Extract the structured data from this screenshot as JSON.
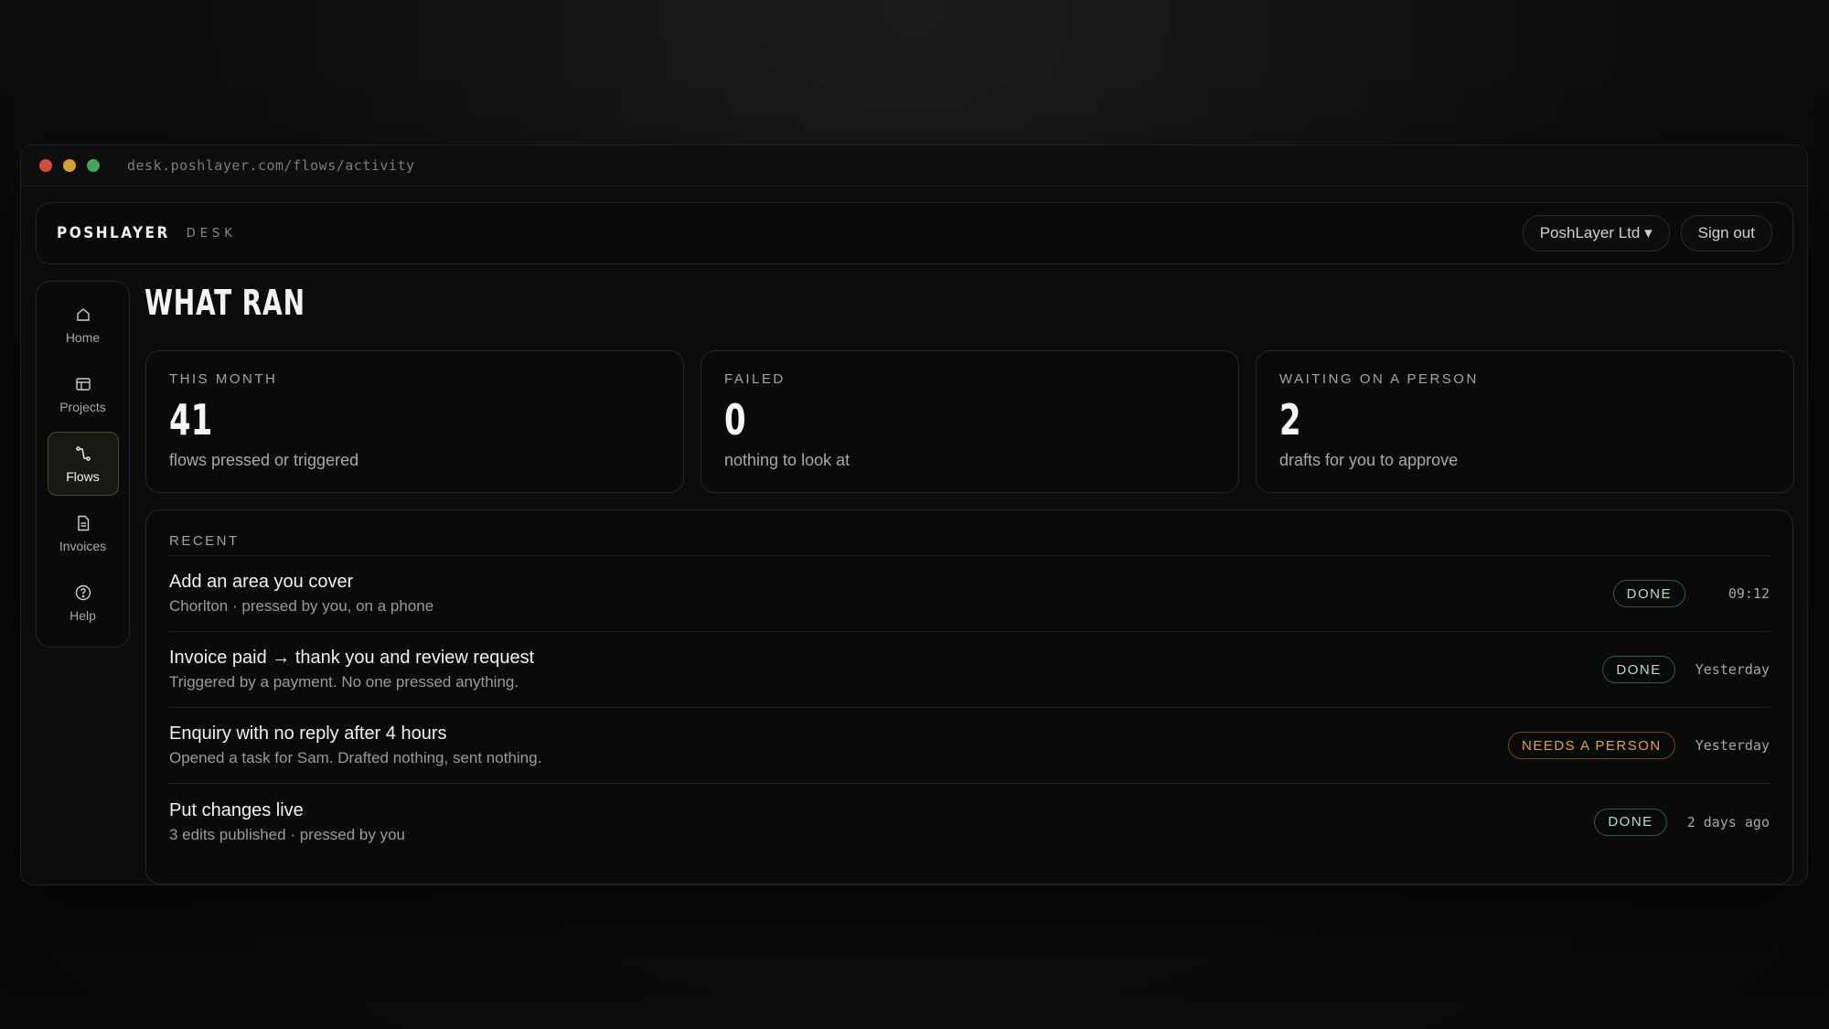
{
  "browser": {
    "url": "desk.poshlayer.com/flows/activity"
  },
  "header": {
    "brand": "POSHLAYER",
    "brand_sub": "DESK",
    "org_selector": "PoshLayer Ltd ▾",
    "sign_out": "Sign out"
  },
  "sidebar": {
    "items": [
      {
        "label": "Home",
        "icon": "home-icon"
      },
      {
        "label": "Projects",
        "icon": "projects-icon"
      },
      {
        "label": "Flows",
        "icon": "flows-icon",
        "active": true
      },
      {
        "label": "Invoices",
        "icon": "invoice-icon"
      },
      {
        "label": "Help",
        "icon": "help-icon"
      }
    ]
  },
  "page": {
    "title": "WHAT RAN"
  },
  "stats": [
    {
      "label": "THIS MONTH",
      "value": "41",
      "desc": "flows pressed or triggered"
    },
    {
      "label": "FAILED",
      "value": "0",
      "desc": "nothing to look at"
    },
    {
      "label": "WAITING ON A PERSON",
      "value": "2",
      "desc": "drafts for you to approve"
    }
  ],
  "recent": {
    "heading": "RECENT",
    "rows": [
      {
        "title": "Add an area you cover",
        "sub": "Chorlton · pressed by you, on a phone",
        "status": "DONE",
        "time": "09:12"
      },
      {
        "title": "Invoice paid → thank you and review request",
        "sub": "Triggered by a payment. No one pressed anything.",
        "status": "DONE",
        "time": "Yesterday"
      },
      {
        "title": "Enquiry with no reply after 4 hours",
        "sub": "Opened a task for Sam. Drafted nothing, sent nothing.",
        "status": "NEEDS A PERSON",
        "time": "Yesterday"
      },
      {
        "title": "Put changes live",
        "sub": "3 edits published · pressed by you",
        "status": "DONE",
        "time": "2 days ago"
      }
    ]
  },
  "colors": {
    "background": "#0b0b0b",
    "done_border": "#2f5a3c",
    "needs_border": "#6a4a1f",
    "needs_text": "#d9a25a",
    "active_nav_border": "#4d4530"
  }
}
